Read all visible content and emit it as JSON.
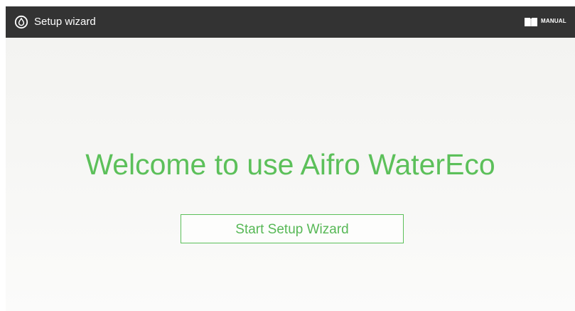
{
  "topbar": {
    "app_icon": "water-drop-icon",
    "title": "Setup wizard",
    "manual_icon": "book-icon",
    "manual_label": "MANUAL"
  },
  "main": {
    "welcome_text": "Welcome to use Aifro WaterEco",
    "start_button_label": "Start Setup Wizard"
  },
  "colors": {
    "topbar_bg": "#333333",
    "accent_green": "#5cc05a",
    "background": "#f5f5f3"
  }
}
